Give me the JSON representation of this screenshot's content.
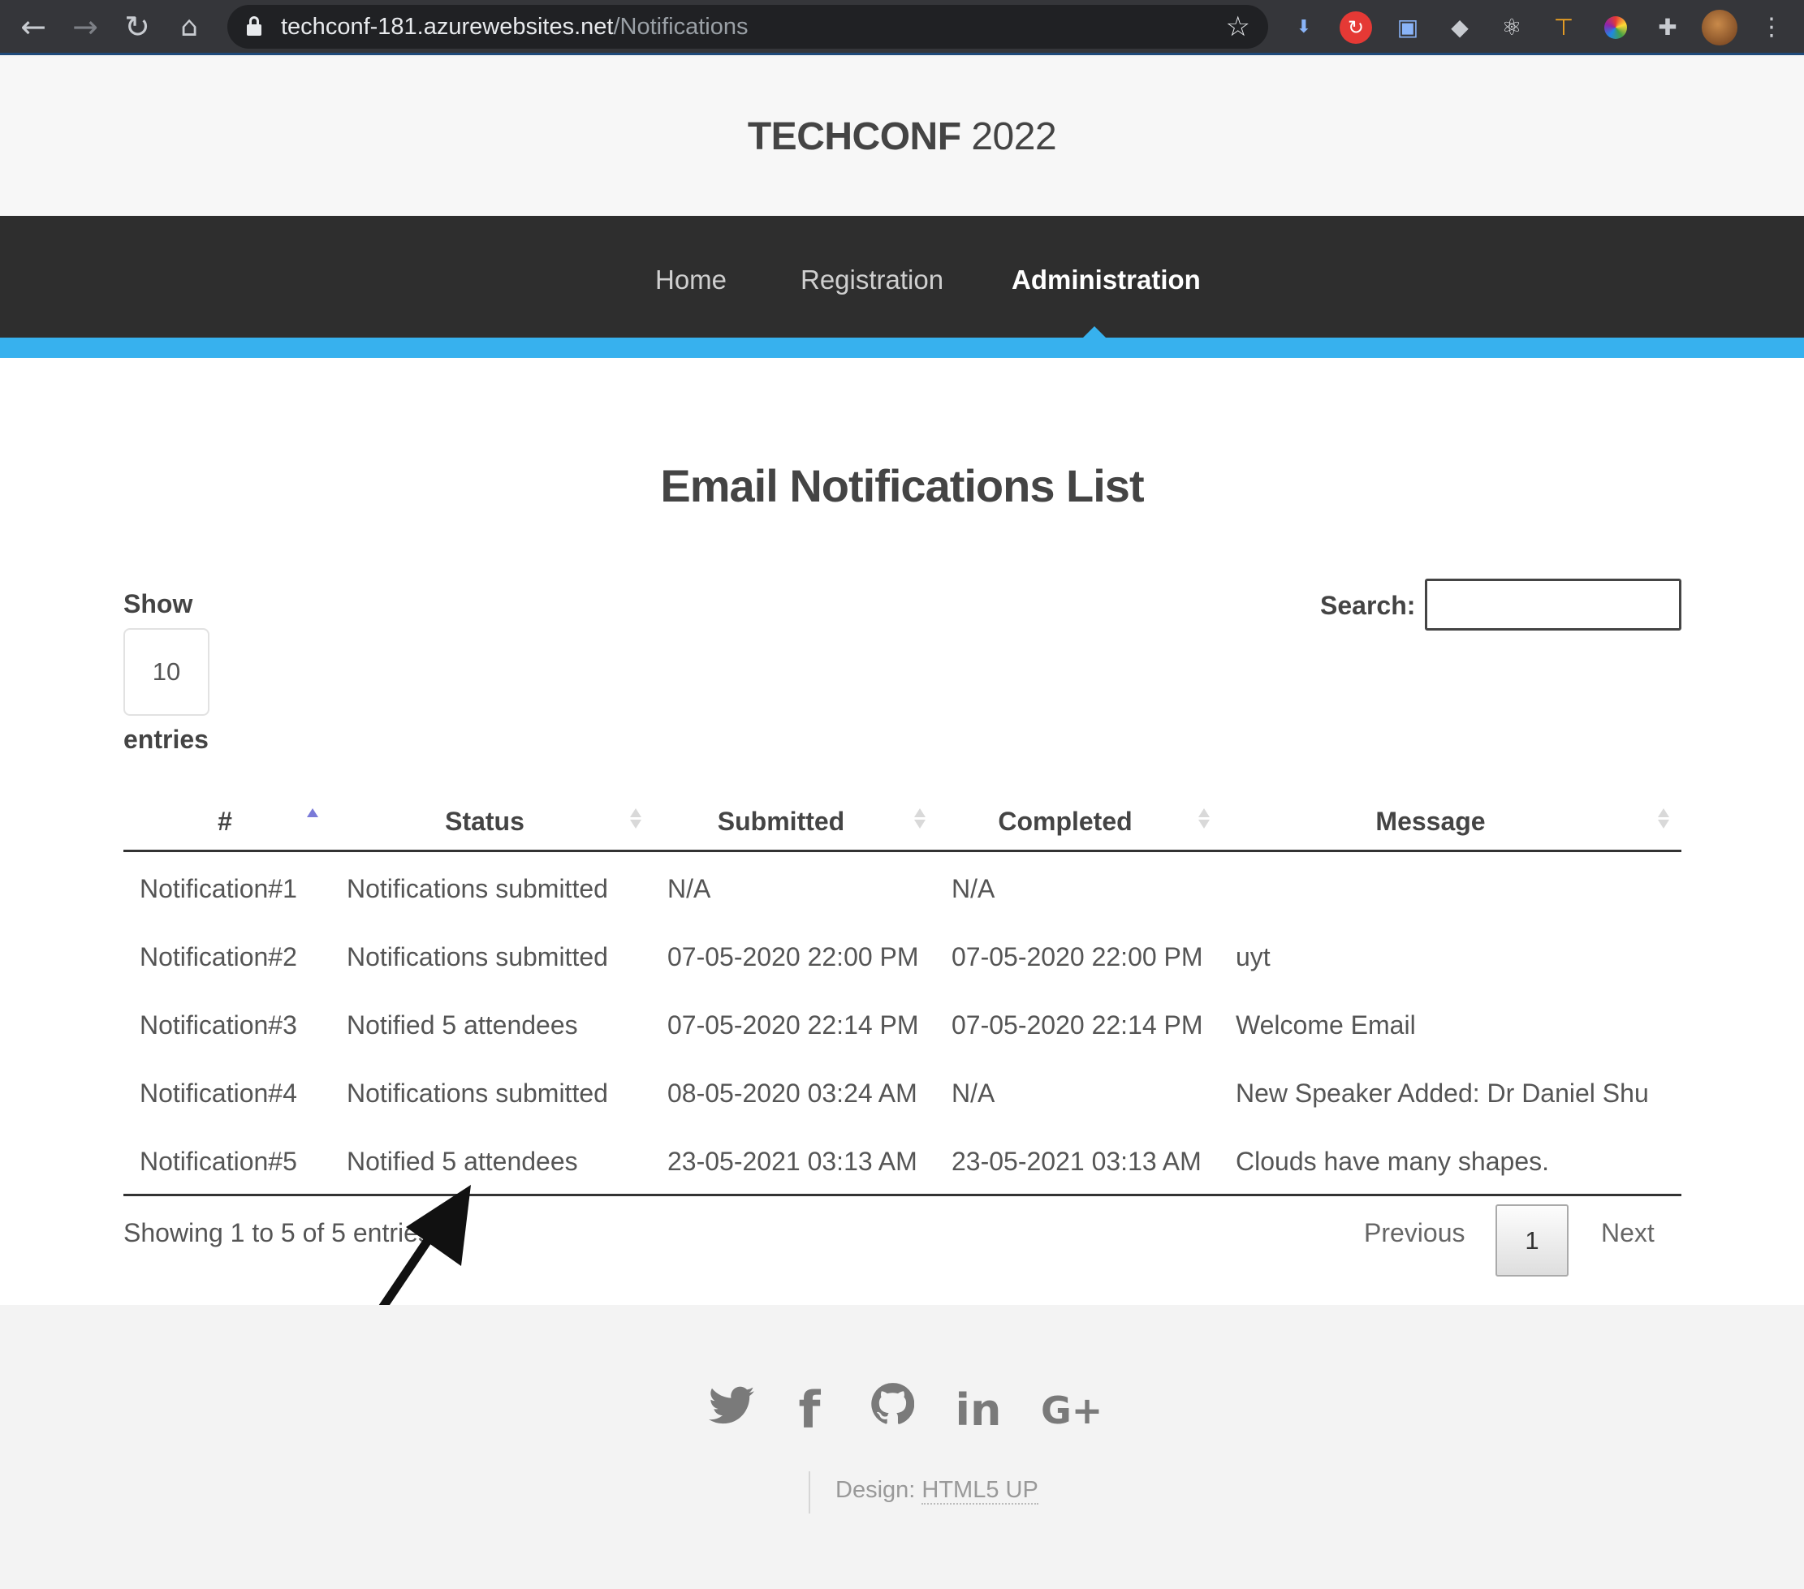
{
  "browser": {
    "url_host": "techconf-181.azurewebsites.net",
    "url_path": "/Notifications",
    "icons": [
      "back-icon",
      "forward-icon",
      "reload-icon",
      "home-icon",
      "star-icon"
    ],
    "extensions": [
      "png-extension-icon",
      "refresh-extension-icon",
      "save-extension-icon",
      "dropbox-extension-icon",
      "react-extension-icon",
      "ruler-extension-icon",
      "color-extension-icon",
      "puzzle-extension-icon",
      "profile-avatar",
      "menu-icon"
    ]
  },
  "site": {
    "brand": "TECHCONF",
    "year": "2022"
  },
  "nav": {
    "items": [
      {
        "label": "Home"
      },
      {
        "label": "Registration"
      },
      {
        "label": "Administration",
        "active": true
      }
    ]
  },
  "main": {
    "title": "Email Notifications List",
    "show_label": "Show",
    "page_length": "10",
    "entries_label": "entries",
    "search_label": "Search:",
    "search_value": ""
  },
  "table": {
    "columns": [
      "#",
      "Status",
      "Submitted",
      "Completed",
      "Message"
    ],
    "rows": [
      [
        "Notification#1",
        "Notifications submitted",
        "N/A",
        "N/A",
        ""
      ],
      [
        "Notification#2",
        "Notifications submitted",
        "07-05-2020 22:00 PM",
        "07-05-2020 22:00 PM",
        "uyt"
      ],
      [
        "Notification#3",
        "Notified 5 attendees",
        "07-05-2020 22:14 PM",
        "07-05-2020 22:14 PM",
        "Welcome Email"
      ],
      [
        "Notification#4",
        "Notifications submitted",
        "08-05-2020 03:24 AM",
        "N/A",
        "New Speaker Added: Dr Daniel Shu"
      ],
      [
        "Notification#5",
        "Notified 5 attendees",
        "23-05-2021 03:13 AM",
        "23-05-2021 03:13 AM",
        "Clouds have many shapes."
      ]
    ]
  },
  "pagination": {
    "info": "Showing 1 to 5 of 5 entries",
    "previous": "Previous",
    "current": "1",
    "next": "Next"
  },
  "footer": {
    "social_icons": [
      "twitter-icon",
      "facebook-icon",
      "github-icon",
      "linkedin-icon",
      "google-plus-icon"
    ],
    "credit_prefix": "Design:",
    "credit_link": "HTML5 UP"
  },
  "colors": {
    "accent": "#37b1ee",
    "nav_bg": "#2e2e2e",
    "chrome_bg": "#35363a"
  }
}
